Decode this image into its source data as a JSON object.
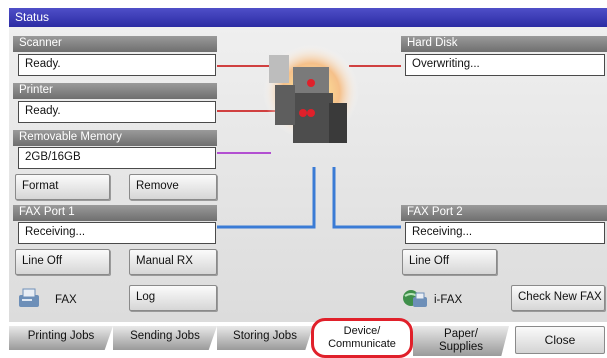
{
  "title": "Status",
  "scanner": {
    "label": "Scanner",
    "value": "Ready."
  },
  "printer": {
    "label": "Printer",
    "value": "Ready."
  },
  "removable_memory": {
    "label": "Removable Memory",
    "value": "2GB/16GB",
    "format_button": "Format",
    "remove_button": "Remove"
  },
  "hard_disk": {
    "label": "Hard Disk",
    "value": "Overwriting..."
  },
  "fax_port_1": {
    "label": "FAX Port 1",
    "value": "Receiving...",
    "line_off_button": "Line Off",
    "manual_rx_button": "Manual RX"
  },
  "fax_port_2": {
    "label": "FAX Port 2",
    "value": "Receiving...",
    "line_off_button": "Line Off"
  },
  "fax": {
    "label": "FAX",
    "log_button": "Log",
    "icon": "fax-icon"
  },
  "ifax": {
    "label": "i-FAX",
    "check_new_fax_button": "Check New FAX",
    "icon": "ifax-icon"
  },
  "tabs": {
    "printing_jobs": "Printing Jobs",
    "sending_jobs": "Sending Jobs",
    "storing_jobs": "Storing Jobs",
    "device_line1": "Device/",
    "device_line2": "Communicate",
    "paper_line1": "Paper/",
    "paper_line2": "Supplies",
    "close": "Close"
  },
  "colors": {
    "title_bar": "#3a3ab5",
    "highlight": "#e0202a",
    "connector_blue": "#3a7bd5",
    "connector_red": "#d04040"
  }
}
